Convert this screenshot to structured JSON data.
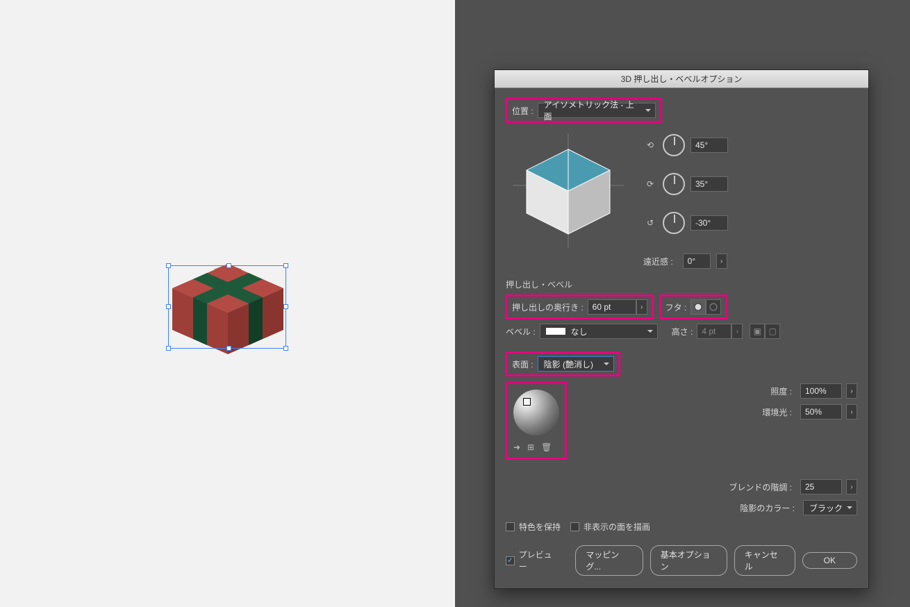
{
  "dialog": {
    "title": "3D 押し出し・ベベルオプション",
    "position_label": "位置 :",
    "position_value": "アイソメトリック法 - 上面",
    "angles": {
      "x": "45°",
      "y": "35°",
      "z": "-30°"
    },
    "perspective_label": "遠近感 :",
    "perspective_value": "0°",
    "extrude_section": "押し出し・ベベル",
    "extrude_depth_label": "押し出しの奥行き :",
    "extrude_depth_value": "60 pt",
    "cap_label": "フタ :",
    "bevel_label": "ベベル :",
    "bevel_value": "なし",
    "height_label": "高さ :",
    "height_value": "4 pt",
    "surface_label": "表面 :",
    "surface_value": "陰影 (艶消し)",
    "intensity_label": "照度 :",
    "intensity_value": "100%",
    "ambient_label": "環境光 :",
    "ambient_value": "50%",
    "blend_label": "ブレンドの階調 :",
    "blend_value": "25",
    "shade_color_label": "陰影のカラー :",
    "shade_color_value": "ブラック",
    "preserve_spot": "特色を保持",
    "draw_hidden": "非表示の面を描画",
    "preview": "プレビュー",
    "btn_map": "マッピング...",
    "btn_basic": "基本オプション",
    "btn_cancel": "キャンセル",
    "btn_ok": "OK"
  }
}
